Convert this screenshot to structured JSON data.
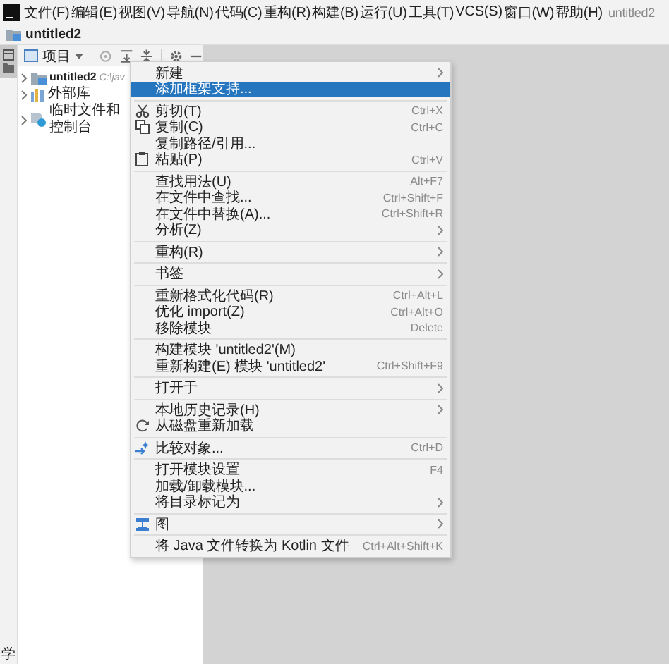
{
  "menu_bar": {
    "items": [
      "文件(F)",
      "编辑(E)",
      "视图(V)",
      "导航(N)",
      "代码(C)",
      "重构(R)",
      "构建(B)",
      "运行(U)",
      "工具(T)",
      "VCS(S)",
      "窗口(W)",
      "帮助(H)"
    ],
    "title": "untitled2"
  },
  "breadcrumb": "untitled2",
  "side_strip": {
    "bottom_label": "学"
  },
  "project_panel": {
    "view_label": "项目",
    "tree": [
      {
        "label": "untitled2",
        "path": "C:\\jav",
        "kind": "module",
        "expanded": false
      },
      {
        "label": "外部库",
        "kind": "library",
        "expanded": false
      },
      {
        "label": "临时文件和控制台",
        "kind": "scratch",
        "expanded": false
      }
    ]
  },
  "context_menu": [
    {
      "kind": "plain",
      "label": "新建",
      "submenu": true,
      "selected": false
    },
    {
      "kind": "plain",
      "label": "添加框架支持...",
      "selected": true
    },
    {
      "kind": "separator"
    },
    {
      "kind": "cut",
      "label": "剪切(T)",
      "shortcut": "Ctrl+X",
      "selected": false
    },
    {
      "kind": "copy",
      "label": "复制(C)",
      "shortcut": "Ctrl+C",
      "selected": false
    },
    {
      "kind": "plain",
      "label": "复制路径/引用...",
      "selected": false
    },
    {
      "kind": "paste",
      "label": "粘贴(P)",
      "shortcut": "Ctrl+V",
      "selected": false
    },
    {
      "kind": "separator"
    },
    {
      "kind": "plain",
      "label": "查找用法(U)",
      "shortcut": "Alt+F7",
      "selected": false
    },
    {
      "kind": "plain",
      "label": "在文件中查找...",
      "shortcut": "Ctrl+Shift+F",
      "selected": false
    },
    {
      "kind": "plain",
      "label": "在文件中替换(A)...",
      "shortcut": "Ctrl+Shift+R",
      "selected": false
    },
    {
      "kind": "plain",
      "label": "分析(Z)",
      "submenu": true,
      "selected": false
    },
    {
      "kind": "separator"
    },
    {
      "kind": "plain",
      "label": "重构(R)",
      "submenu": true,
      "selected": false
    },
    {
      "kind": "separator"
    },
    {
      "kind": "plain",
      "label": "书签",
      "submenu": true,
      "selected": false
    },
    {
      "kind": "separator"
    },
    {
      "kind": "plain",
      "label": "重新格式化代码(R)",
      "shortcut": "Ctrl+Alt+L",
      "selected": false
    },
    {
      "kind": "plain",
      "label": "优化 import(Z)",
      "shortcut": "Ctrl+Alt+O",
      "selected": false
    },
    {
      "kind": "plain",
      "label": "移除模块",
      "shortcut": "Delete",
      "selected": false
    },
    {
      "kind": "separator"
    },
    {
      "kind": "plain",
      "label": "构建模块 'untitled2'(M)",
      "selected": false
    },
    {
      "kind": "plain",
      "label": "重新构建(E) 模块 'untitled2'",
      "shortcut": "Ctrl+Shift+F9",
      "selected": false
    },
    {
      "kind": "separator"
    },
    {
      "kind": "plain",
      "label": "打开于",
      "submenu": true,
      "selected": false
    },
    {
      "kind": "separator"
    },
    {
      "kind": "plain",
      "label": "本地历史记录(H)",
      "submenu": true,
      "selected": false
    },
    {
      "kind": "reload",
      "label": "从磁盘重新加载",
      "selected": false
    },
    {
      "kind": "separator"
    },
    {
      "kind": "compare",
      "label": "比较对象...",
      "shortcut": "Ctrl+D",
      "selected": false
    },
    {
      "kind": "separator"
    },
    {
      "kind": "plain",
      "label": "打开模块设置",
      "shortcut": "F4",
      "selected": false
    },
    {
      "kind": "plain",
      "label": "加载/卸载模块...",
      "selected": false
    },
    {
      "kind": "plain",
      "label": "将目录标记为",
      "submenu": true,
      "selected": false
    },
    {
      "kind": "separator"
    },
    {
      "kind": "diagram",
      "label": "图",
      "submenu": true,
      "selected": false
    },
    {
      "kind": "separator"
    },
    {
      "kind": "plain",
      "label": "将 Java 文件转换为 Kotlin 文件",
      "shortcut": "Ctrl+Alt+Shift+K",
      "selected": false
    }
  ]
}
